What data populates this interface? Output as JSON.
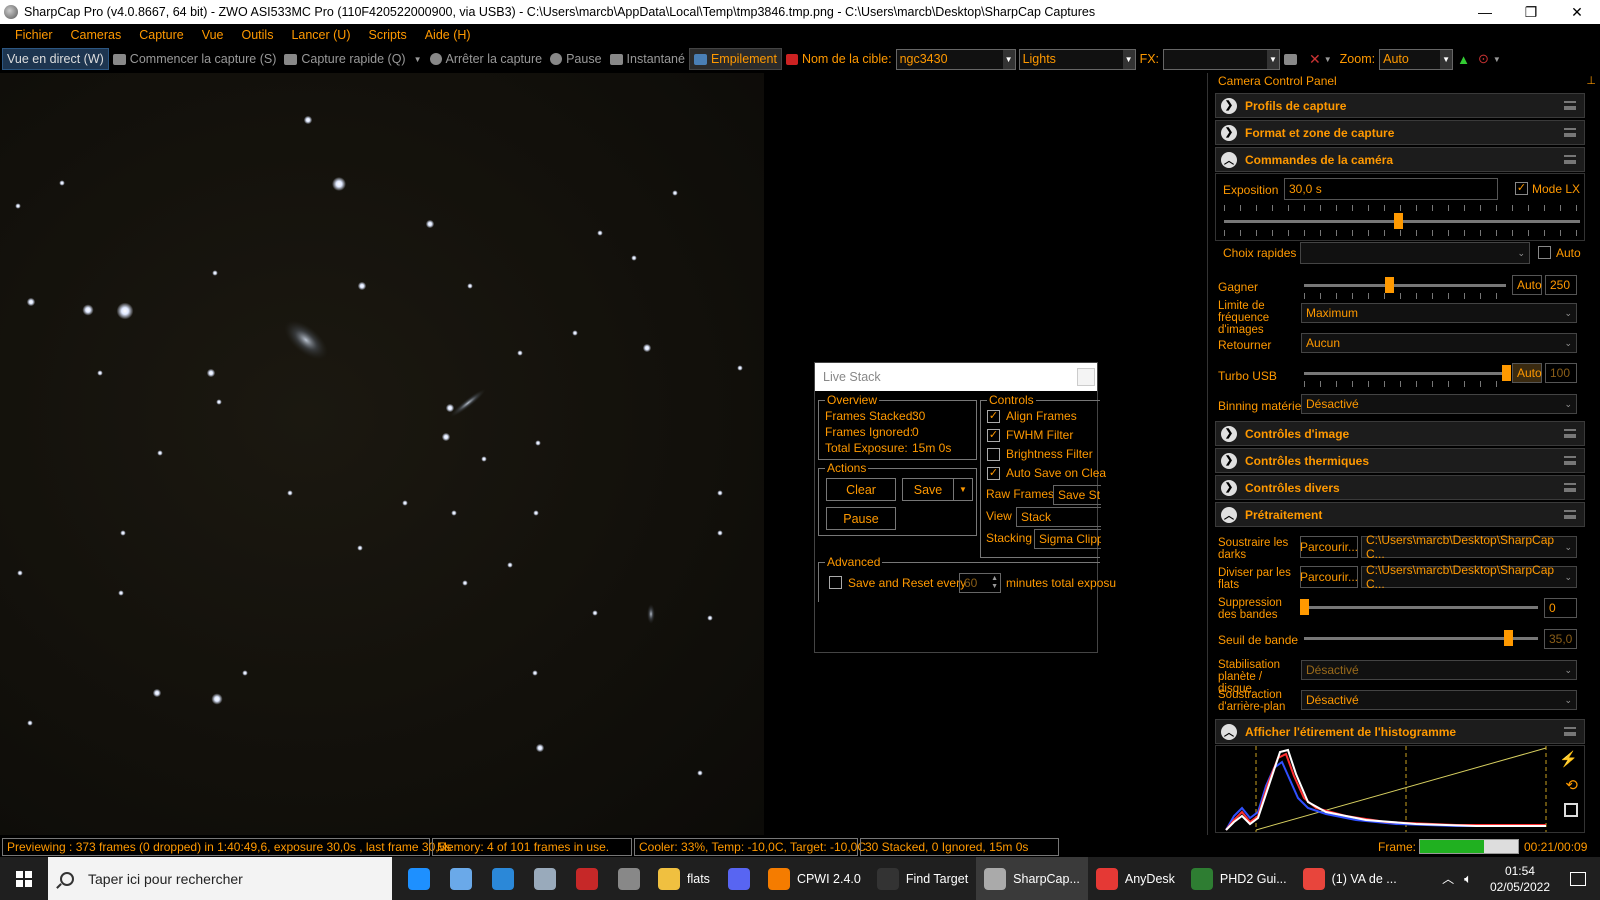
{
  "window": {
    "title": "SharpCap Pro (v4.0.8667, 64 bit) - ZWO ASI533MC Pro (110F420522000900, via USB3) - C:\\Users\\marcb\\AppData\\Local\\Temp\\tmp3846.tmp.png - C:\\Users\\marcb\\Desktop\\SharpCap Captures",
    "minimize": "—",
    "maximize": "❐",
    "close": "✕"
  },
  "menu": [
    "Fichier",
    "Cameras",
    "Capture",
    "Vue",
    "Outils",
    "Lancer (U)",
    "Scripts",
    "Aide (H)"
  ],
  "toolbar": {
    "live_view": "Vue en direct (W)",
    "start_capture": "Commencer la capture (S)",
    "quick_capture": "Capture rapide (Q)",
    "stop_capture": "Arrêter la capture",
    "pause": "Pause",
    "snapshot": "Instantané",
    "stacking": "Empilement",
    "target_label": "Nom de la cible:",
    "target_value": "ngc3430",
    "frame_type": "Lights",
    "fx_label": "FX:",
    "fx_value": "",
    "zoom_label": "Zoom:",
    "zoom_value": "Auto"
  },
  "panel": {
    "title": "Camera Control Panel",
    "sections": {
      "profiles": "Profils de capture",
      "format": "Format et zone de capture",
      "camera": "Commandes de la caméra",
      "image": "Contrôles d'image",
      "thermal": "Contrôles thermiques",
      "misc": "Contrôles divers",
      "preprocessing": "Prétraitement",
      "histogram": "Afficher l'étirement de l'histogramme"
    },
    "camera": {
      "exposure_label": "Exposition",
      "exposure_value": "30,0 s",
      "lx_mode_label": "Mode LX",
      "lx_mode_checked": true,
      "exposure_position": 0.49,
      "quick_choice_label": "Choix rapides",
      "quick_choice_value": "",
      "quick_auto_label": "Auto",
      "gain_label": "Gagner",
      "gain_auto": "Auto",
      "gain_value": "250",
      "gain_position": 0.42,
      "fps_label": "Limite de fréquence d'images",
      "fps_value": "Maximum",
      "flip_label": "Retourner",
      "flip_value": "Aucun",
      "usb_label": "Turbo USB",
      "usb_auto": "Auto",
      "usb_value": "100",
      "usb_position": 1.0,
      "binning_label": "Binning matériel",
      "binning_value": "Désactivé"
    },
    "preprocessing": {
      "darks_label": "Soustraire les darks",
      "darks_browse": "Parcourir...",
      "darks_path": "C:\\Users\\marcb\\Desktop\\SharpCap C...",
      "flats_label": "Diviser par les flats",
      "flats_browse": "Parcourir...",
      "flats_path": "C:\\Users\\marcb\\Desktop\\SharpCap C...",
      "banding_label": "Suppression des bandes",
      "banding_value": "0",
      "banding_position": 0.0,
      "threshold_label": "Seuil de bande",
      "threshold_value": "35,0",
      "threshold_position": 0.87,
      "stabilization_label": "Stabilisation planète / disque",
      "stabilization_value": "Désactivé",
      "background_label": "Soustraction d'arrière-plan",
      "background_value": "Désactivé"
    }
  },
  "live_stack": {
    "title": "Live Stack",
    "overview_label": "Overview",
    "frames_stacked_label": "Frames Stacked:",
    "frames_stacked": "30",
    "frames_ignored_label": "Frames Ignored:",
    "frames_ignored": "0",
    "total_exposure_label": "Total Exposure:",
    "total_exposure": "15m 0s",
    "actions_label": "Actions",
    "clear": "Clear",
    "save": "Save",
    "pause": "Pause",
    "controls_label": "Controls",
    "align_frames": "Align Frames",
    "align_checked": true,
    "fwhm_filter": "FWHM Filter",
    "fwhm_checked": true,
    "brightness_filter": "Brightness Filter",
    "brightness_checked": false,
    "auto_save": "Auto Save on Clea",
    "auto_save_checked": true,
    "raw_frames_label": "Raw Frames",
    "raw_frames_value": "Save St",
    "view_label": "View",
    "view_value": "Stack",
    "stacking_label": "Stacking",
    "stacking_value": "Sigma Clipp",
    "advanced_label": "Advanced",
    "save_reset_label": "Save and Reset every",
    "save_reset_value": "60",
    "save_reset_suffix": "minutes total exposu"
  },
  "status": {
    "preview": "Previewing : 373 frames (0 dropped) in 1:40:49,6, exposure 30,0s , last frame 30,5s",
    "memory": "Memory: 4 of 101 frames in use.",
    "cooler": "Cooler: 33%, Temp: -10,0C, Target: -10,0C",
    "stacked": "30 Stacked, 0 Ignored, 15m 0s",
    "frame_label": "Frame:",
    "frame_progress": 0.65,
    "frame_time": "00:21/00:09"
  },
  "taskbar": {
    "search_placeholder": "Taper ici pour rechercher",
    "items": [
      {
        "label": "",
        "color": "#1e90ff",
        "icon": "edge-icon"
      },
      {
        "label": "",
        "color": "#6aa9e9",
        "icon": "app-icon"
      },
      {
        "label": "",
        "color": "#2b88d8",
        "icon": "ccleaner-icon"
      },
      {
        "label": "",
        "color": "#9ab",
        "icon": "weather-icon"
      },
      {
        "label": "",
        "color": "#c62828",
        "icon": "pdf-icon"
      },
      {
        "label": "",
        "color": "#888",
        "icon": "star-icon"
      },
      {
        "label": "flats",
        "color": "#f0c040",
        "icon": "folder-icon"
      },
      {
        "label": "",
        "color": "#5865f2",
        "icon": "discord-icon"
      },
      {
        "label": "CPWI 2.4.0",
        "color": "#f57c00",
        "icon": "cpwi-icon"
      },
      {
        "label": "Find Target",
        "color": "#333",
        "icon": "cpwi-target-icon"
      },
      {
        "label": "SharpCap...",
        "color": "#aaa",
        "icon": "sharpcap-icon"
      },
      {
        "label": "AnyDesk",
        "color": "#e53935",
        "icon": "anydesk-icon"
      },
      {
        "label": "PHD2 Gui...",
        "color": "#2e7d32",
        "icon": "phd2-icon"
      },
      {
        "label": "(1) VA de ...",
        "color": "#e8453c",
        "icon": "chrome-icon"
      }
    ],
    "time": "01:54",
    "date": "02/05/2022"
  }
}
